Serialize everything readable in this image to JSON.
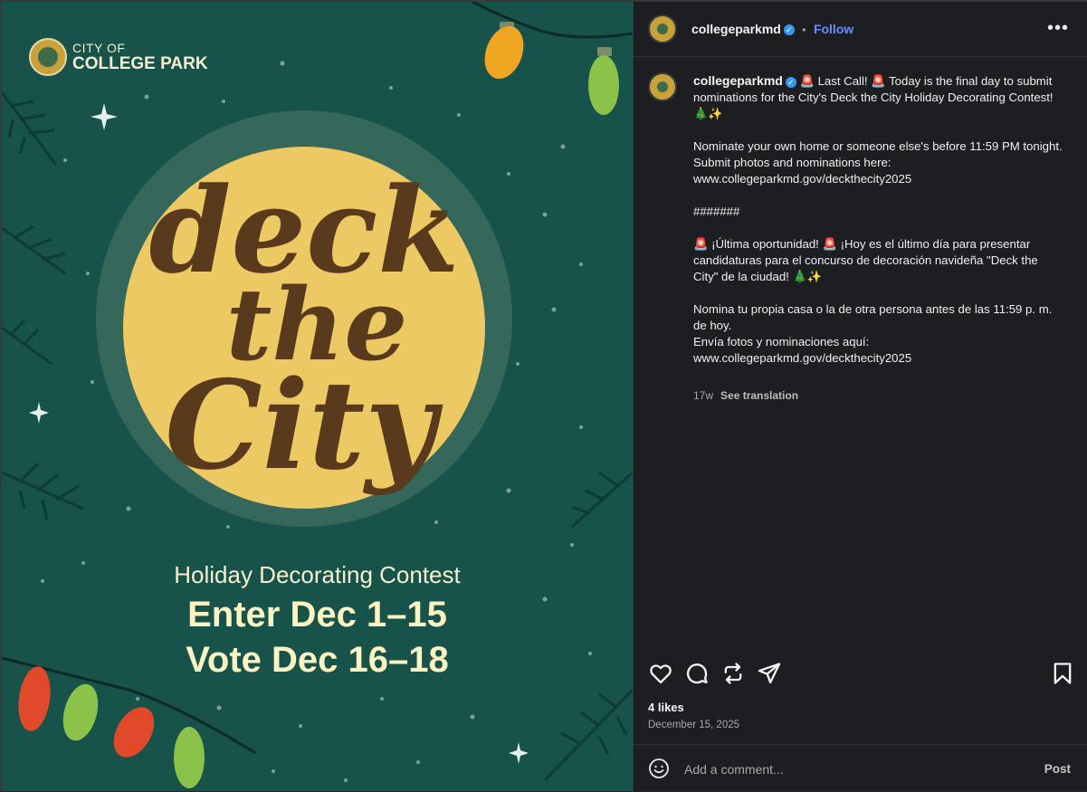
{
  "image": {
    "logo_line1": "CITY OF",
    "logo_line2": "COLLEGE PARK",
    "headline_words": [
      "deck",
      "the",
      "City"
    ],
    "subtitle": "Holiday Decorating Contest",
    "enter_line": "Enter Dec 1–15",
    "vote_line": "Vote Dec 16–18"
  },
  "header": {
    "username": "collegeparkmd",
    "separator": "•",
    "follow_label": "Follow",
    "more_label": "•••"
  },
  "caption": {
    "username": "collegeparkmd",
    "paragraphs": [
      "🚨 Last Call! 🚨 Today is the final day to submit nominations for the City's Deck the City Holiday Decorating Contest! 🎄✨",
      "Nominate your own home or someone else's before 11:59 PM tonight.\nSubmit photos and nominations here:\nwww.collegeparkmd.gov/deckthecity2025",
      "#######",
      "🚨 ¡Última oportunidad! 🚨 ¡Hoy es el último día para presentar candidaturas para el concurso de decoración navideña \"Deck the City\" de la ciudad! 🎄✨",
      "Nomina tu propia casa o la de otra persona antes de las 11:59 p. m. de hoy.\nEnvía fotos y nominaciones aquí:\nwww.collegeparkmd.gov/deckthecity2025"
    ],
    "age": "17w",
    "see_translation": "See translation"
  },
  "actions": {
    "icons": [
      "heart-icon",
      "comment-icon",
      "repost-icon",
      "share-icon",
      "bookmark-icon"
    ]
  },
  "likes": "4 likes",
  "date": "December 15, 2025",
  "comment": {
    "placeholder": "Add a comment...",
    "post_label": "Post"
  },
  "colors": {
    "poster_bg": "#17524b",
    "moon": "#ecc962",
    "lettering": "#5a3a1c",
    "panel_bg": "#1d1e21",
    "follow": "#6b8cff",
    "verified": "#3897f0"
  }
}
